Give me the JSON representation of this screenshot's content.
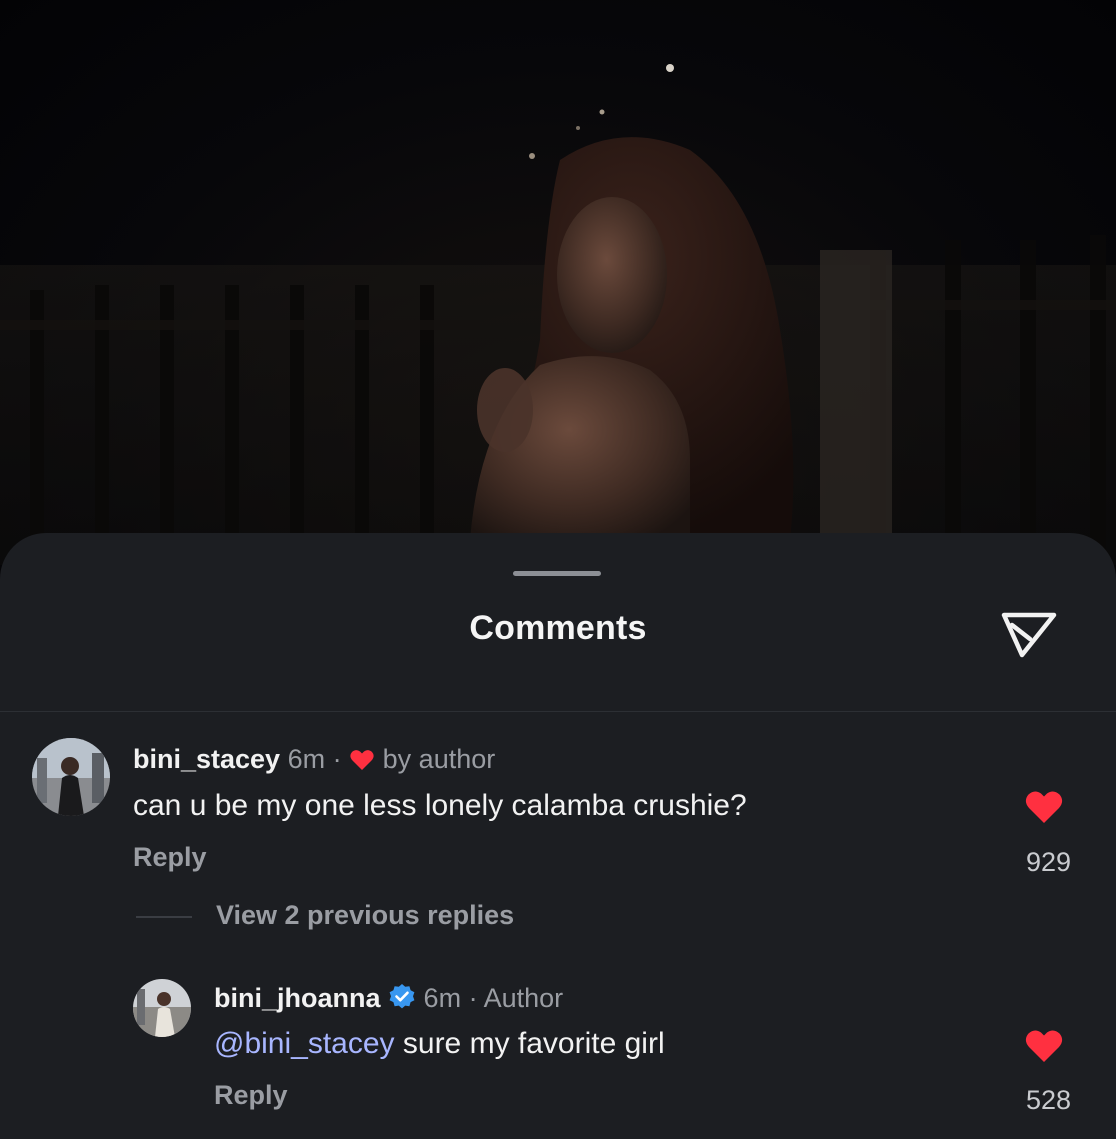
{
  "sheet": {
    "title": "Comments",
    "share_icon": "paper-plane-icon"
  },
  "comments": [
    {
      "username": "bini_stacey",
      "time": "6m",
      "separator": "·",
      "liked_by_author_label": "by author",
      "text": "can u be my one less lonely calamba crushie?",
      "reply_label": "Reply",
      "like_count": "929",
      "liked": true,
      "view_replies_label": "View 2 previous replies"
    },
    {
      "username": "bini_jhoanna",
      "verified": true,
      "time": "6m",
      "separator": "·",
      "role_label": "Author",
      "mention": "@bini_stacey",
      "text": " sure my favorite girl",
      "reply_label": "Reply",
      "like_count": "528",
      "liked": true
    }
  ],
  "colors": {
    "sheet_bg": "#1c1e22",
    "like_red": "#ff3040",
    "mention_blue": "#a8b6ff",
    "verified_blue": "#3897f0"
  }
}
